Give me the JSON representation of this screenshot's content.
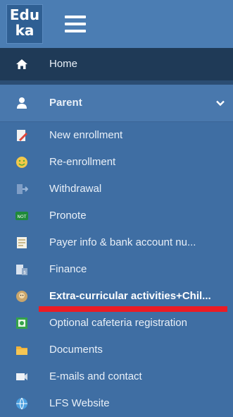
{
  "app": {
    "logo_line1": "Edu",
    "logo_line2": "ka"
  },
  "menu": {
    "home": "Home",
    "parent": "Parent",
    "items": [
      {
        "label": "New enrollment",
        "icon": "pencil-paper-icon"
      },
      {
        "label": "Re-enrollment",
        "icon": "smiley-icon"
      },
      {
        "label": "Withdrawal",
        "icon": "exit-icon"
      },
      {
        "label": "Pronote",
        "icon": "pronote-icon"
      },
      {
        "label": "Payer info & bank account nu...",
        "icon": "document-icon"
      },
      {
        "label": "Finance",
        "icon": "finance-icon"
      },
      {
        "label": "Extra-curricular activities+Chil...",
        "icon": "activity-icon"
      },
      {
        "label": "Optional cafeteria registration",
        "icon": "cafeteria-icon"
      },
      {
        "label": "Documents",
        "icon": "folder-icon"
      },
      {
        "label": "E-mails and contact",
        "icon": "email-icon"
      },
      {
        "label": "LFS Website",
        "icon": "globe-icon"
      }
    ]
  },
  "colors": {
    "accent_red": "#ec1c24",
    "sidebar_bg": "#3f6ea3",
    "home_bg": "#1f3a57"
  }
}
